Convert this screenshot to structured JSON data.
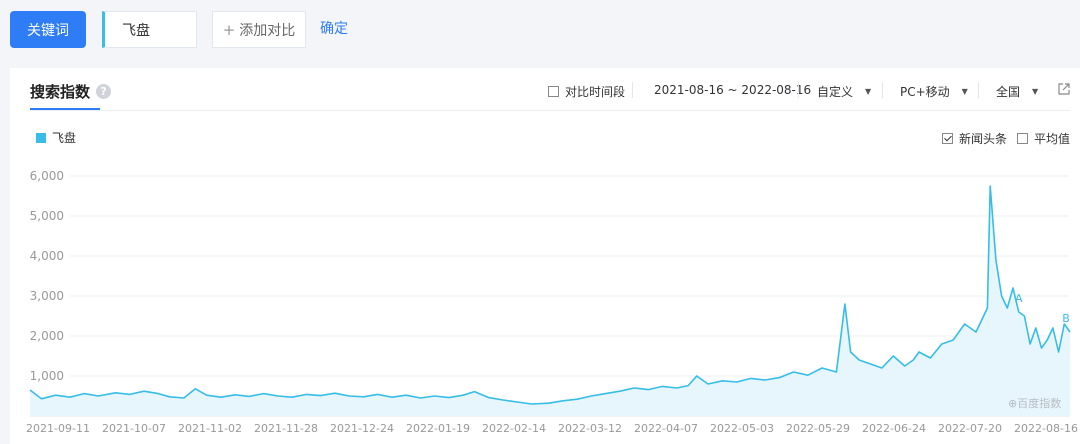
{
  "toolbar": {
    "keyword_button": "关键词",
    "keyword_value": "飞盘",
    "add_compare": "添加对比",
    "add_icon": "+",
    "confirm": "确定"
  },
  "card": {
    "title": "搜索指数",
    "help_icon": "?",
    "compare_period": "对比时间段",
    "date_range": "2021-08-16 ~ 2022-08-16",
    "custom": "自定义",
    "device": "PC+移动",
    "region": "全国",
    "legend_label": "飞盘",
    "news_label": "新闻头条",
    "news_checked": true,
    "avg_label": "平均值",
    "avg_checked": false,
    "watermark": "⊕百度指数"
  },
  "chart_data": {
    "type": "area",
    "series": [
      {
        "name": "飞盘",
        "color": "#37bde8"
      }
    ],
    "y_ticks": [
      "1,000",
      "2,000",
      "3,000",
      "4,000",
      "5,000",
      "6,000"
    ],
    "ylim": [
      0,
      6000
    ],
    "x_ticks": [
      "2021-09-11",
      "2021-10-07",
      "2021-11-02",
      "2021-11-28",
      "2021-12-24",
      "2022-01-19",
      "2022-02-14",
      "2022-03-12",
      "2022-04-07",
      "2022-05-03",
      "2022-05-29",
      "2022-06-24",
      "2022-07-20",
      "2022-08-16"
    ],
    "annotations": [
      {
        "label": "A",
        "date": "2022-07-29"
      },
      {
        "label": "B",
        "date": "2022-08-16"
      }
    ],
    "points": [
      [
        "2021-08-16",
        650
      ],
      [
        "2021-08-20",
        430
      ],
      [
        "2021-08-25",
        520
      ],
      [
        "2021-08-30",
        470
      ],
      [
        "2021-09-04",
        560
      ],
      [
        "2021-09-09",
        500
      ],
      [
        "2021-09-15",
        580
      ],
      [
        "2021-09-20",
        540
      ],
      [
        "2021-09-25",
        620
      ],
      [
        "2021-09-30",
        560
      ],
      [
        "2021-10-04",
        480
      ],
      [
        "2021-10-09",
        450
      ],
      [
        "2021-10-13",
        680
      ],
      [
        "2021-10-17",
        520
      ],
      [
        "2021-10-22",
        470
      ],
      [
        "2021-10-27",
        530
      ],
      [
        "2021-11-01",
        490
      ],
      [
        "2021-11-06",
        560
      ],
      [
        "2021-11-11",
        500
      ],
      [
        "2021-11-16",
        470
      ],
      [
        "2021-11-21",
        540
      ],
      [
        "2021-11-26",
        510
      ],
      [
        "2021-12-01",
        570
      ],
      [
        "2021-12-06",
        500
      ],
      [
        "2021-12-11",
        480
      ],
      [
        "2021-12-16",
        540
      ],
      [
        "2021-12-21",
        470
      ],
      [
        "2021-12-26",
        520
      ],
      [
        "2021-12-31",
        450
      ],
      [
        "2022-01-05",
        500
      ],
      [
        "2022-01-10",
        460
      ],
      [
        "2022-01-15",
        520
      ],
      [
        "2022-01-19",
        610
      ],
      [
        "2022-01-24",
        460
      ],
      [
        "2022-01-29",
        400
      ],
      [
        "2022-02-03",
        350
      ],
      [
        "2022-02-08",
        300
      ],
      [
        "2022-02-14",
        320
      ],
      [
        "2022-02-19",
        380
      ],
      [
        "2022-02-24",
        420
      ],
      [
        "2022-03-01",
        500
      ],
      [
        "2022-03-06",
        560
      ],
      [
        "2022-03-11",
        620
      ],
      [
        "2022-03-16",
        700
      ],
      [
        "2022-03-21",
        660
      ],
      [
        "2022-03-26",
        740
      ],
      [
        "2022-03-31",
        700
      ],
      [
        "2022-04-04",
        760
      ],
      [
        "2022-04-07",
        1000
      ],
      [
        "2022-04-11",
        800
      ],
      [
        "2022-04-16",
        880
      ],
      [
        "2022-04-21",
        850
      ],
      [
        "2022-04-26",
        940
      ],
      [
        "2022-05-01",
        900
      ],
      [
        "2022-05-06",
        960
      ],
      [
        "2022-05-11",
        1100
      ],
      [
        "2022-05-16",
        1020
      ],
      [
        "2022-05-21",
        1200
      ],
      [
        "2022-05-26",
        1100
      ],
      [
        "2022-05-29",
        2800
      ],
      [
        "2022-05-31",
        1600
      ],
      [
        "2022-06-03",
        1400
      ],
      [
        "2022-06-07",
        1300
      ],
      [
        "2022-06-11",
        1200
      ],
      [
        "2022-06-15",
        1500
      ],
      [
        "2022-06-19",
        1250
      ],
      [
        "2022-06-22",
        1400
      ],
      [
        "2022-06-24",
        1600
      ],
      [
        "2022-06-28",
        1450
      ],
      [
        "2022-07-02",
        1800
      ],
      [
        "2022-07-06",
        1900
      ],
      [
        "2022-07-10",
        2300
      ],
      [
        "2022-07-14",
        2100
      ],
      [
        "2022-07-18",
        2700
      ],
      [
        "2022-07-19",
        5750
      ],
      [
        "2022-07-21",
        3900
      ],
      [
        "2022-07-23",
        3000
      ],
      [
        "2022-07-25",
        2700
      ],
      [
        "2022-07-27",
        3200
      ],
      [
        "2022-07-29",
        2600
      ],
      [
        "2022-07-31",
        2500
      ],
      [
        "2022-08-02",
        1800
      ],
      [
        "2022-08-04",
        2200
      ],
      [
        "2022-08-06",
        1700
      ],
      [
        "2022-08-08",
        1900
      ],
      [
        "2022-08-10",
        2200
      ],
      [
        "2022-08-12",
        1600
      ],
      [
        "2022-08-14",
        2300
      ],
      [
        "2022-08-16",
        2100
      ]
    ]
  }
}
